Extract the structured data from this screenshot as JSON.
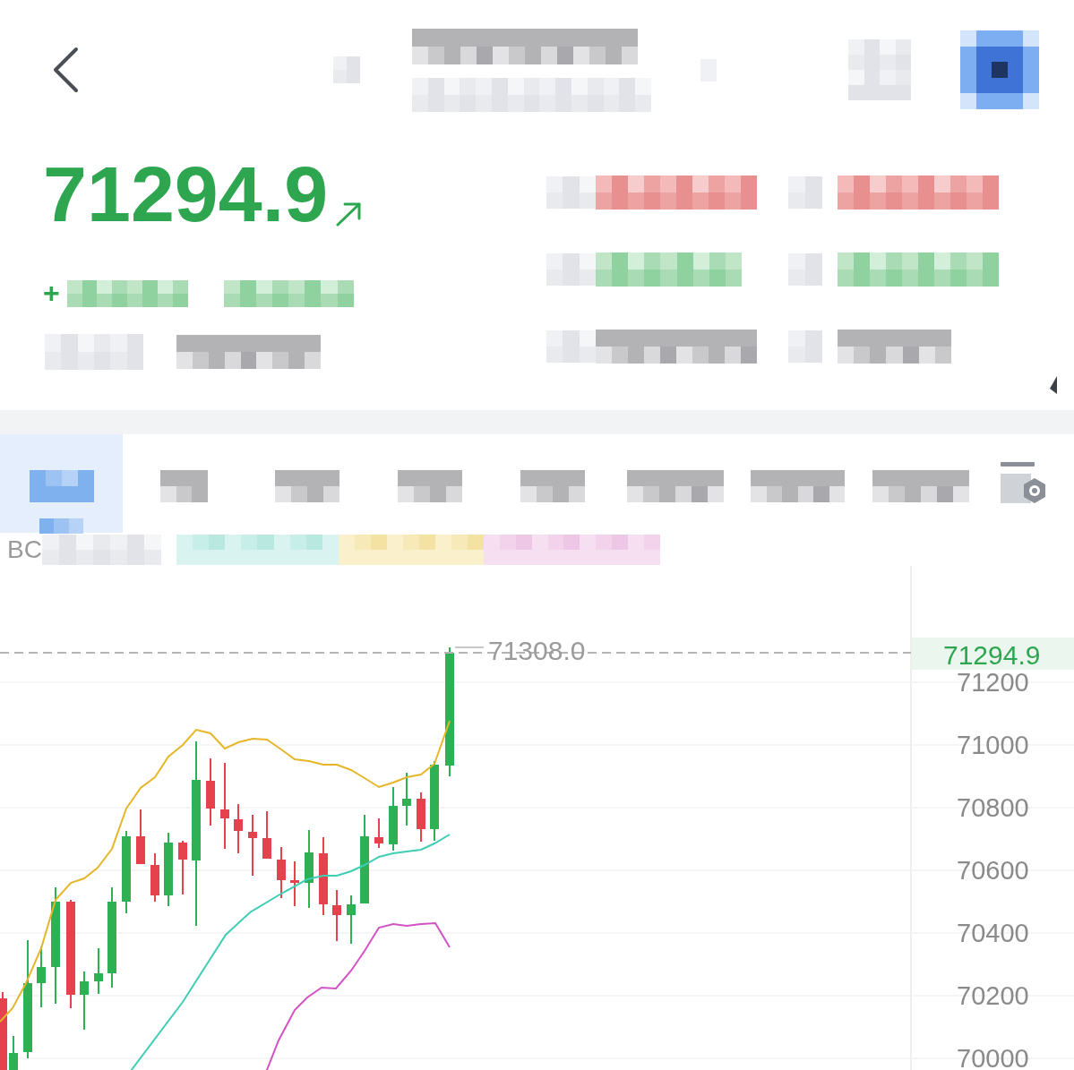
{
  "quote": {
    "price": "71294.9",
    "change_sign": "+"
  },
  "interval_tabs": [
    {
      "selected": true
    },
    {
      "selected": false
    },
    {
      "selected": false
    },
    {
      "selected": false
    },
    {
      "selected": false
    },
    {
      "selected": false
    },
    {
      "selected": false
    },
    {
      "selected": false
    }
  ],
  "indicator_legend": {
    "label": "BC"
  },
  "chart": {
    "max_price_label": "71308.0",
    "current_price_tag": "71294.9",
    "y_axis_labels": [
      "71200",
      "71000",
      "70800",
      "70600",
      "70400",
      "70200",
      "70000"
    ]
  }
}
